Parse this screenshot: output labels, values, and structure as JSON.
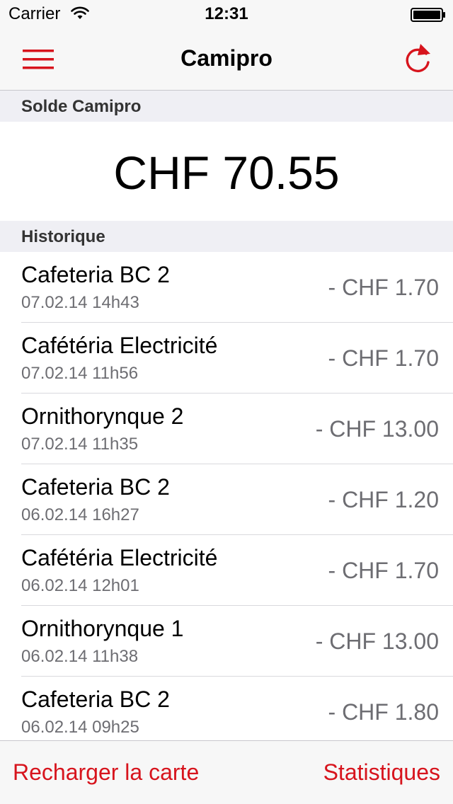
{
  "status_bar": {
    "carrier": "Carrier",
    "time": "12:31"
  },
  "nav": {
    "title": "Camipro",
    "menu_icon": "hamburger-icon",
    "refresh_icon": "refresh-icon"
  },
  "balance": {
    "section_label": "Solde Camipro",
    "value": "CHF 70.55"
  },
  "history": {
    "section_label": "Historique",
    "items": [
      {
        "name": "Cafeteria BC 2",
        "date": "07.02.14 14h43",
        "amount": "- CHF 1.70"
      },
      {
        "name": "Cafétéria Electricité",
        "date": "07.02.14 11h56",
        "amount": "- CHF 1.70"
      },
      {
        "name": "Ornithorynque 2",
        "date": "07.02.14 11h35",
        "amount": "- CHF 13.00"
      },
      {
        "name": "Cafeteria BC 2",
        "date": "06.02.14 16h27",
        "amount": "- CHF 1.20"
      },
      {
        "name": "Cafétéria Electricité",
        "date": "06.02.14 12h01",
        "amount": "- CHF 1.70"
      },
      {
        "name": "Ornithorynque 1",
        "date": "06.02.14 11h38",
        "amount": "- CHF 13.00"
      },
      {
        "name": "Cafeteria BC 2",
        "date": "06.02.14 09h25",
        "amount": "- CHF 1.80"
      }
    ]
  },
  "toolbar": {
    "recharge_label": "Recharger la carte",
    "stats_label": "Statistiques"
  },
  "colors": {
    "accent": "#d7141d",
    "bar_bg": "#f7f7f7",
    "section_bg": "#efeff4",
    "secondary_text": "#6d6d72"
  }
}
